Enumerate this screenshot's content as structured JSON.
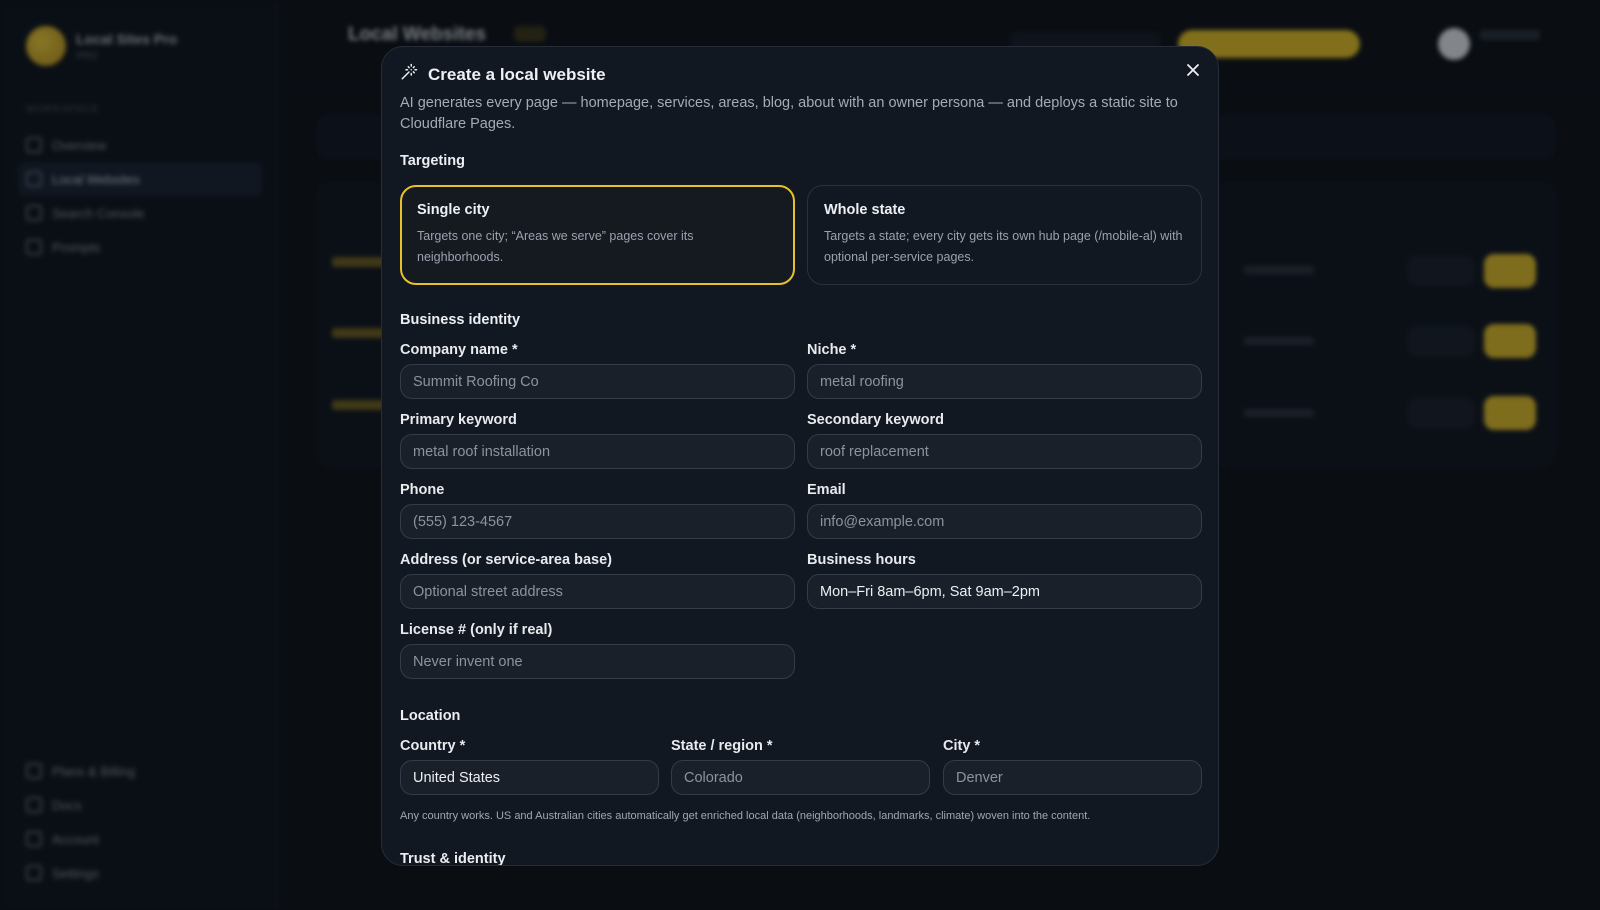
{
  "background": {
    "app_name": "Local Sites Pro",
    "app_plan": "PRO",
    "section_label": "WORKSPACE",
    "nav": [
      "Overview",
      "Local Websites",
      "Search Console",
      "Prompts"
    ],
    "nav_bottom": [
      "Plans & Billing",
      "Docs",
      "Account",
      "Settings"
    ],
    "page_title": "Local Websites"
  },
  "modal": {
    "title": "Create a local website",
    "description": "AI generates every page — homepage, services, areas, blog, about with an owner persona — and deploys a static site to Cloudflare Pages.",
    "targeting": {
      "section": "Targeting",
      "options": [
        {
          "title": "Single city",
          "desc": "Targets one city; “Areas we serve” pages cover its neighborhoods.",
          "selected": true
        },
        {
          "title": "Whole state",
          "desc": "Targets a state; every city gets its own hub page (/mobile-al) with optional per-service pages.",
          "selected": false
        }
      ]
    },
    "identity": {
      "section": "Business identity",
      "company_name": {
        "label": "Company name *",
        "placeholder": "Summit Roofing Co",
        "value": ""
      },
      "niche": {
        "label": "Niche *",
        "placeholder": "metal roofing",
        "value": ""
      },
      "primary_keyword": {
        "label": "Primary keyword",
        "placeholder": "metal roof installation",
        "value": ""
      },
      "secondary_keyword": {
        "label": "Secondary keyword",
        "placeholder": "roof replacement",
        "value": ""
      },
      "phone": {
        "label": "Phone",
        "placeholder": "(555) 123-4567",
        "value": ""
      },
      "email": {
        "label": "Email",
        "placeholder": "info@example.com",
        "value": ""
      },
      "address": {
        "label": "Address (or service-area base)",
        "placeholder": "Optional street address",
        "value": ""
      },
      "hours": {
        "label": "Business hours",
        "placeholder": "",
        "value": "Mon–Fri 8am–6pm, Sat 9am–2pm"
      },
      "license": {
        "label": "License # (only if real)",
        "placeholder": "Never invent one",
        "value": ""
      }
    },
    "location": {
      "section": "Location",
      "country": {
        "label": "Country *",
        "placeholder": "",
        "value": "United States"
      },
      "state": {
        "label": "State / region *",
        "placeholder": "Colorado",
        "value": ""
      },
      "city": {
        "label": "City *",
        "placeholder": "Denver",
        "value": ""
      },
      "hint": "Any country works. US and Australian cities automatically get enriched local data (neighborhoods, landmarks, climate) woven into the content."
    },
    "trust": {
      "section": "Trust & identity"
    }
  },
  "icons": {
    "title_icon": "magic-wand-icon",
    "close_icon": "close-icon"
  },
  "colors": {
    "accent": "#e6c12a",
    "modal_bg": "#121821",
    "page_bg": "#0d1117"
  }
}
